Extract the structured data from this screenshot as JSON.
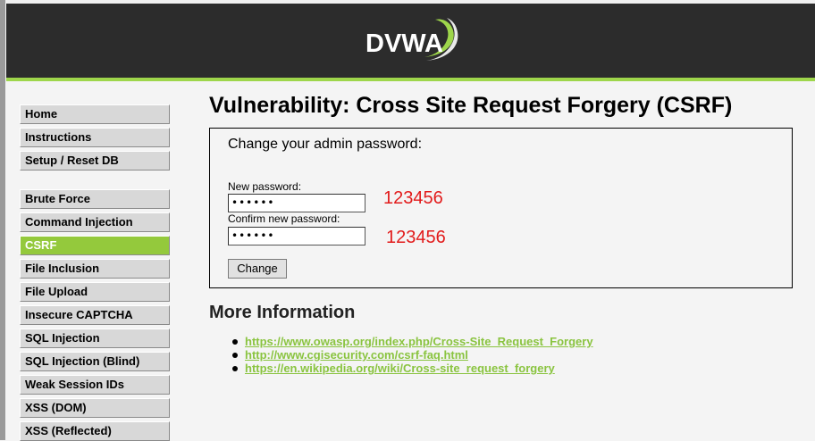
{
  "header": {
    "logo_text": "DVWA",
    "colors": {
      "background": "#2c2c2c",
      "accent": "#9ed64b"
    }
  },
  "menu": {
    "group1": [
      "Home",
      "Instructions",
      "Setup / Reset DB"
    ],
    "group2": [
      "Brute Force",
      "Command Injection",
      "CSRF",
      "File Inclusion",
      "File Upload",
      "Insecure CAPTCHA",
      "SQL Injection",
      "SQL Injection (Blind)",
      "Weak Session IDs",
      "XSS (DOM)",
      "XSS (Reflected)"
    ],
    "selected": "CSRF",
    "selected_color": "#94c93c"
  },
  "main": {
    "title": "Vulnerability: Cross Site Request Forgery (CSRF)",
    "form": {
      "heading": "Change your admin password:",
      "new_password_label": "New password:",
      "new_password_value": "••••••",
      "confirm_password_label": "Confirm new password:",
      "confirm_password_value": "••••••",
      "submit_label": "Change"
    },
    "annotations": [
      "123456",
      "123456"
    ],
    "annotation_color": "#e21b1b",
    "more_info": {
      "title": "More Information",
      "links": [
        "https://www.owasp.org/index.php/Cross-Site_Request_Forgery",
        "http://www.cgisecurity.com/csrf-faq.html",
        "https://en.wikipedia.org/wiki/Cross-site_request_forgery"
      ],
      "link_color": "#8ac440"
    }
  }
}
